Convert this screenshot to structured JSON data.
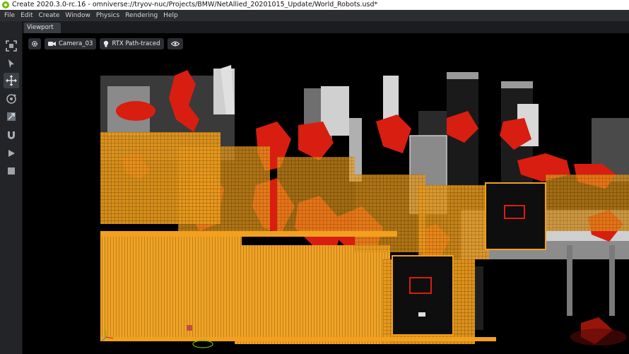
{
  "title_bar": {
    "text": "Create 2020.3.0-rc.16 - omniverse://tryov-nuc/Projects/BMW/NetAllied_20201015_Update/World_Robots.usd*"
  },
  "menu": {
    "items": [
      "File",
      "Edit",
      "Create",
      "Window",
      "Physics",
      "Rendering",
      "Help"
    ]
  },
  "left_toolbar": {
    "tools": [
      "select-frame-icon",
      "select-arrow-icon",
      "move-icon",
      "rotate-icon",
      "scale-icon",
      "snap-magnet-icon",
      "play-icon",
      "stop-icon"
    ],
    "active_tool": "move-icon"
  },
  "tabs": {
    "viewport_label": "Viewport"
  },
  "viewport_toolbar": {
    "settings_icon": "gear-icon",
    "camera_label": "Camera_03",
    "renderer_label": "RTX Path-traced",
    "visibility_icon": "eye-icon"
  },
  "colors": {
    "accent_orange": "#f2a01e",
    "robot_red": "#d81e10",
    "nvidia_green": "#76b900"
  }
}
